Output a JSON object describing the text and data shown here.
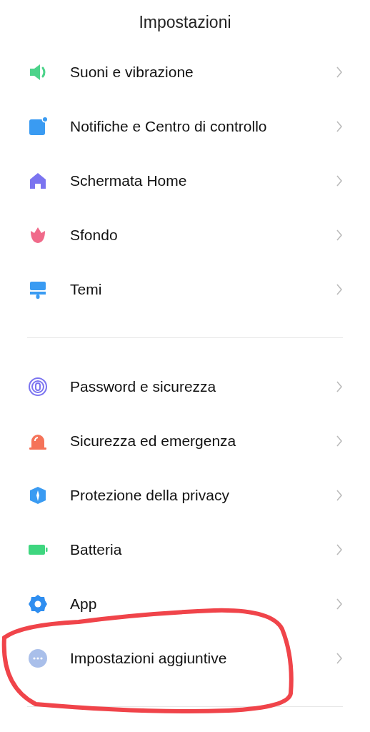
{
  "title": "Impostazioni",
  "sections": [
    {
      "items": [
        {
          "label": "Suoni e vibrazione",
          "circled": false
        },
        {
          "label": "Notifiche e Centro di controllo",
          "circled": false
        },
        {
          "label": "Schermata Home",
          "circled": false
        },
        {
          "label": "Sfondo",
          "circled": false
        },
        {
          "label": "Temi",
          "circled": false
        }
      ]
    },
    {
      "items": [
        {
          "label": "Password e sicurezza",
          "circled": false
        },
        {
          "label": "Sicurezza ed emergenza",
          "circled": false
        },
        {
          "label": "Protezione della privacy",
          "circled": false
        },
        {
          "label": "Batteria",
          "circled": false
        },
        {
          "label": "App",
          "circled": false
        },
        {
          "label": "Impostazioni aggiuntive",
          "circled": true
        }
      ]
    }
  ]
}
